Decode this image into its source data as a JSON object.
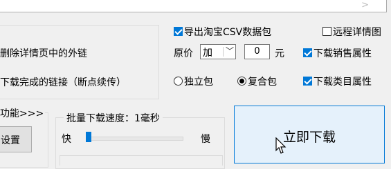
{
  "top": {
    "scroll_arrow": ">"
  },
  "left": {
    "remove_links": "删除详情页中的外链",
    "download_done": "下载完成的链接（断点续传）",
    "more_functions": "功能>>>",
    "settings_button": "设置"
  },
  "options": {
    "export_csv": {
      "label": "导出淘宝CSV数据包",
      "checked": true
    },
    "remote_detail": {
      "label": "远程详情图",
      "checked": false
    },
    "price_label": "原价",
    "price_op": "加",
    "price_value": "0",
    "price_unit": "元",
    "download_sales": {
      "label": "下载销售属性",
      "checked": true
    },
    "download_category": {
      "label": "下载类目属性",
      "checked": true
    },
    "radio_independent": {
      "label": "独立包",
      "selected": false
    },
    "radio_composite": {
      "label": "复合包",
      "selected": true
    }
  },
  "speed": {
    "title": "批量下载速度：1毫秒",
    "fast": "快",
    "slow": "慢",
    "level": 0.0
  },
  "download_now": "立即下载",
  "colors": {
    "accent": "#0078d7",
    "button_hover": "#e5f1fb"
  }
}
